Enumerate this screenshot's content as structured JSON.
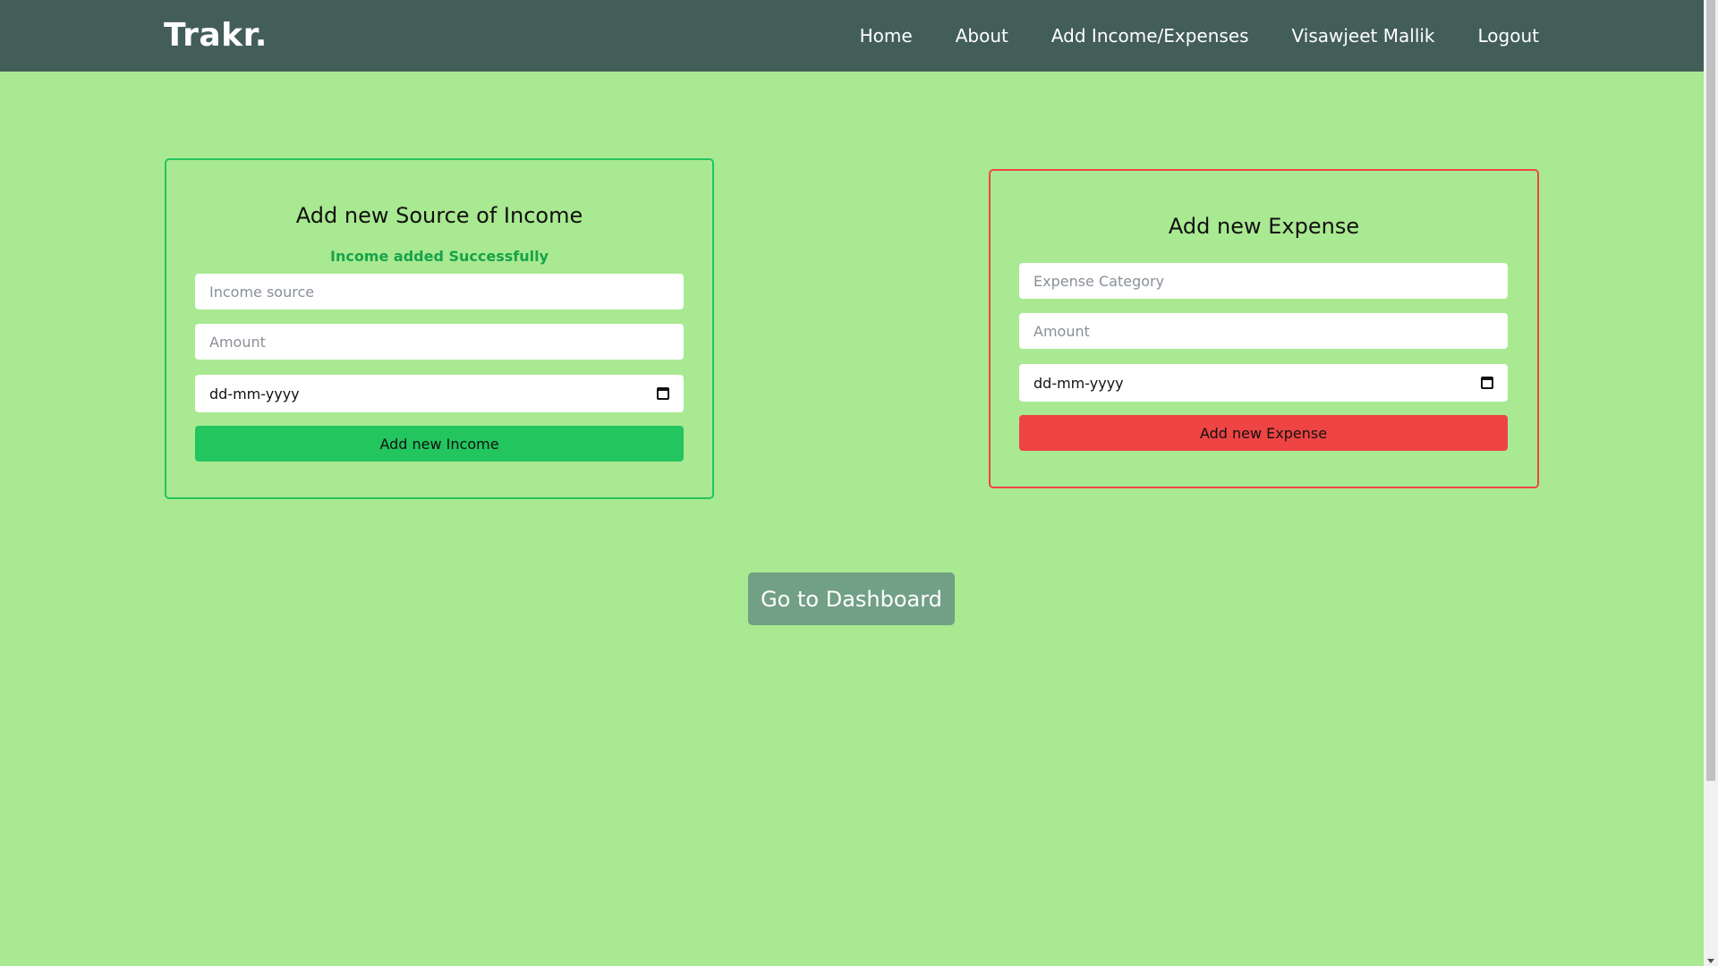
{
  "navbar": {
    "brand": "Trakr.",
    "links": [
      "Home",
      "About",
      "Add Income/Expenses",
      "Visawjeet Mallik",
      "Logout"
    ]
  },
  "income_card": {
    "title": "Add new Source of Income",
    "success_message": "Income added Successfully",
    "source_placeholder": "Income source",
    "amount_placeholder": "Amount",
    "date_placeholder": "dd-mm-yyyy",
    "submit_label": "Add new Income"
  },
  "expense_card": {
    "title": "Add new Expense",
    "category_placeholder": "Expense Category",
    "amount_placeholder": "Amount",
    "date_placeholder": "dd-mm-yyyy",
    "submit_label": "Add new Expense"
  },
  "dashboard_button": "Go to Dashboard",
  "colors": {
    "background": "#a9e991",
    "navbar": "#435d58",
    "income_accent": "#22c55e",
    "expense_accent": "#ef4444",
    "dashboard_button": "#72a085"
  }
}
